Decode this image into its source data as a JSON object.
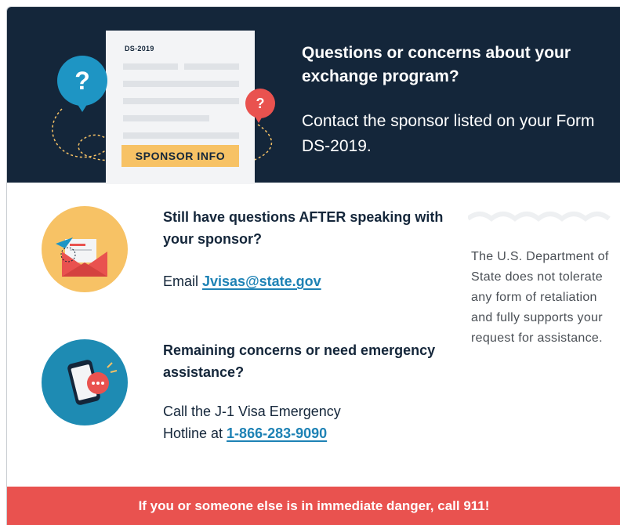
{
  "header": {
    "form_label": "DS-2019",
    "sponsor_badge": "SPONSOR INFO",
    "bubble_blue_mark": "?",
    "bubble_red_mark": "?",
    "title": "Questions or concerns about your exchange program?",
    "subtitle": "Contact the sponsor listed on your Form DS-2019."
  },
  "email_section": {
    "title": "Still have questions AFTER speaking with your sponsor?",
    "prefix": "Email ",
    "link": "Jvisas@state.gov",
    "icon": "envelope-icon"
  },
  "hotline_section": {
    "title": "Remaining concerns or need emergency assistance?",
    "text_line1": "Call the J-1 Visa Emergency",
    "text_line2_prefix": "Hotline at ",
    "link": "1-866-283-9090",
    "icon": "phone-icon"
  },
  "side_note": "The U.S. Department of State does not tolerate any form of retaliation and fully supports your request for assistance.",
  "footer": "If you or someone else is in immediate danger, call 911!",
  "colors": {
    "navy": "#14263a",
    "blue": "#1e95c4",
    "red": "#e9524f",
    "yellow": "#f7c265",
    "link": "#1e82b5"
  }
}
